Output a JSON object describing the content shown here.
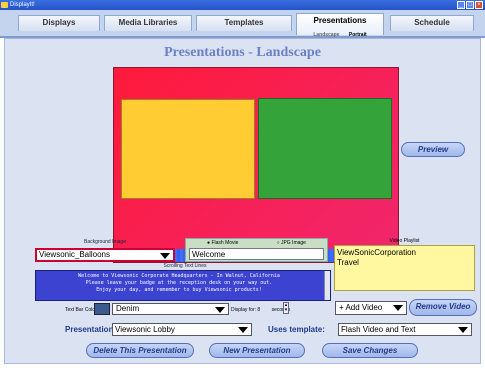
{
  "window": {
    "title": "DisplayIt!"
  },
  "tabs": [
    {
      "label": "Displays"
    },
    {
      "label": "Media Libraries"
    },
    {
      "label": "Templates"
    },
    {
      "label": "Presentations",
      "active": true
    },
    {
      "label": "Schedule"
    }
  ],
  "subtabs": {
    "landscape": "Landscape",
    "portrait": "Portrait"
  },
  "page": {
    "title": "Presentations - Landscape"
  },
  "preview": {
    "label": "Preview"
  },
  "background": {
    "label": "Background Image",
    "value": "Viewsonic_Balloons"
  },
  "media_type": {
    "option_flash": "Flash Movie",
    "option_jpg": "JPG Image",
    "selected": "Flash Movie",
    "value": "Welcome"
  },
  "scrolling": {
    "label": "Scrolling Text Lines",
    "lines": [
      "Welcome to Viewsonic Corporate Headquarters - In Walnut, California",
      "Please leave your badge at the reception desk on your way out.",
      "Enjoy your day, and remember to buy Viewsonic products!"
    ]
  },
  "textbar": {
    "color_label": "Text Bar Color:",
    "color_value": "Denim",
    "color_hex": "#3b5b8e",
    "display_label": "Display for:",
    "seconds_value": "8",
    "seconds_label": "seconds"
  },
  "playlist": {
    "label": "Video Playlist",
    "items": [
      "ViewSonicCorporation",
      "Travel"
    ],
    "add_label": "+ Add Video",
    "remove_label": "Remove Video"
  },
  "presentation": {
    "label": "Presentation:",
    "value": "Viewsonic Lobby",
    "template_label": "Uses template:",
    "template_value": "Flash Video and Text"
  },
  "actions": {
    "delete": "Delete This Presentation",
    "new": "New Presentation",
    "save": "Save Changes"
  },
  "colors": {
    "canvas_bg": "#f0266e",
    "zone_left": "#ffcc33",
    "zone_right": "#33a33a",
    "ticker": "#3d6dff",
    "scroll_bg": "#3c43d0",
    "playlist_bg": "#fff8a0"
  }
}
